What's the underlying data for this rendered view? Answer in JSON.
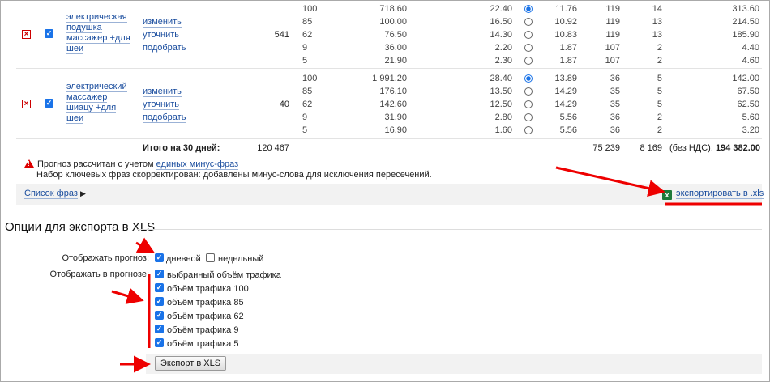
{
  "rows": [
    {
      "title": [
        "электрическая",
        "подушка",
        "массажер +для",
        "шеи"
      ],
      "actions": [
        "изменить",
        "уточнить",
        "подобрать"
      ],
      "count": "541",
      "sub": [
        {
          "vol": "100",
          "a": "718.60",
          "b": "22.40",
          "c": "11.76",
          "d": "119",
          "e": "14",
          "f": "313.60",
          "sel": true
        },
        {
          "vol": "85",
          "a": "100.00",
          "b": "16.50",
          "c": "10.92",
          "d": "119",
          "e": "13",
          "f": "214.50",
          "sel": false
        },
        {
          "vol": "62",
          "a": "76.50",
          "b": "14.30",
          "c": "10.83",
          "d": "119",
          "e": "13",
          "f": "185.90",
          "sel": false
        },
        {
          "vol": "9",
          "a": "36.00",
          "b": "2.20",
          "c": "1.87",
          "d": "107",
          "e": "2",
          "f": "4.40",
          "sel": false
        },
        {
          "vol": "5",
          "a": "21.90",
          "b": "2.30",
          "c": "1.87",
          "d": "107",
          "e": "2",
          "f": "4.60",
          "sel": false
        }
      ]
    },
    {
      "title": [
        "электрический",
        "массажер",
        "шиацу +для",
        "шеи"
      ],
      "actions": [
        "изменить",
        "уточнить",
        "подобрать"
      ],
      "count": "40",
      "sub": [
        {
          "vol": "100",
          "a": "1 991.20",
          "b": "28.40",
          "c": "13.89",
          "d": "36",
          "e": "5",
          "f": "142.00",
          "sel": true
        },
        {
          "vol": "85",
          "a": "176.10",
          "b": "13.50",
          "c": "14.29",
          "d": "35",
          "e": "5",
          "f": "67.50",
          "sel": false
        },
        {
          "vol": "62",
          "a": "142.60",
          "b": "12.50",
          "c": "14.29",
          "d": "35",
          "e": "5",
          "f": "62.50",
          "sel": false
        },
        {
          "vol": "9",
          "a": "31.90",
          "b": "2.80",
          "c": "5.56",
          "d": "36",
          "e": "2",
          "f": "5.60",
          "sel": false
        },
        {
          "vol": "5",
          "a": "16.90",
          "b": "1.60",
          "c": "5.56",
          "d": "36",
          "e": "2",
          "f": "3.20",
          "sel": false
        }
      ]
    }
  ],
  "totals": {
    "label": "Итого на 30 дней:",
    "count": "120 467",
    "t1": "75 239",
    "t2": "8 169",
    "vat_label": "(без НДС):",
    "vat_value": "194 382.00"
  },
  "notice": {
    "line1_prefix": "Прогноз рассчитан с учетом",
    "line1_link": "единых минус-фраз",
    "line2": "Набор ключевых фраз скорректирован: добавлены минус-слова для исключения пересечений."
  },
  "phrase_list_link": "Список фраз",
  "export_link": "экспортировать в .xls",
  "options": {
    "heading": "Опции для экспорта в XLS",
    "forecast_label": "Отображать прогноз:",
    "daily_label": "дневной",
    "weekly_label": "недельный",
    "in_forecast_label": "Отображать в прогнозе:",
    "items": [
      "выбранный объём трафика",
      "объём трафика 100",
      "объём трафика 85",
      "объём трафика 62",
      "объём трафика 9",
      "объём трафика 5"
    ],
    "export_button": "Экспорт в XLS"
  },
  "colors": {
    "accent": "#1a73e8",
    "link": "#1a4d9e",
    "arrow": "#e00000",
    "excel": "#1f7a3a"
  }
}
